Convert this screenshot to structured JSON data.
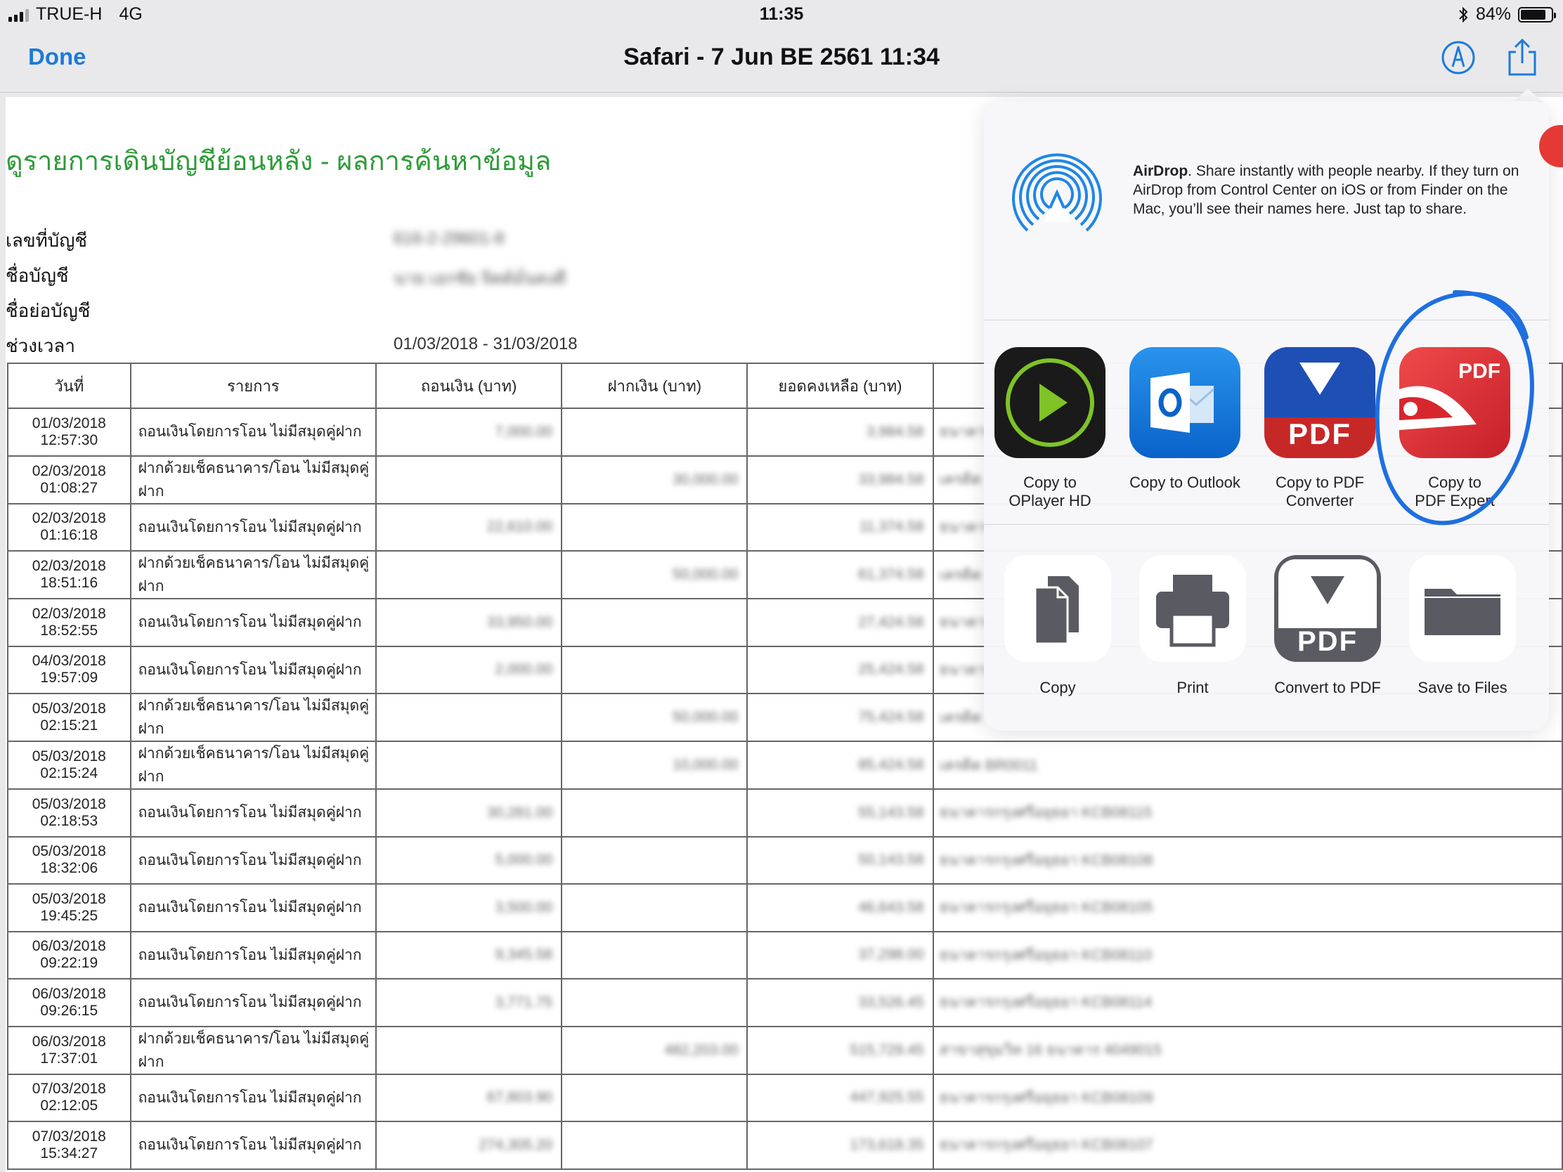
{
  "status_bar": {
    "carrier": "TRUE-H",
    "network": "4G",
    "time": "11:35",
    "battery_percent": "84%",
    "battery_level": 0.84
  },
  "nav": {
    "done_label": "Done",
    "title": "Safari - 7 Jun BE 2561 11:34"
  },
  "document": {
    "title": "ดูรายการเดินบัญชีย้อนหลัง - ผลการค้นหาข้อมูล",
    "fields": [
      {
        "label": "เลขที่บัญชี",
        "value": "616-2-29601-8"
      },
      {
        "label": "ชื่อบัญชี",
        "value": "นาย เอกชัย จิตต์มั่นคงดี"
      },
      {
        "label": "ชื่อย่อบัญชี",
        "value": ""
      },
      {
        "label": "ช่วงเวลา",
        "value": "01/03/2018 - 31/03/2018"
      }
    ],
    "table": {
      "headers": [
        "วันที่",
        "รายการ",
        "ถอนเงิน (บาท)",
        "ฝากเงิน (บาท)",
        "ยอดคงเหลือ (บาท)",
        ""
      ],
      "rows": [
        {
          "date": "01/03/2018",
          "time": "12:57:30",
          "desc": "ถอนเงินโดยการโอน ไม่มีสมุดคู่ฝาก",
          "withdraw": "7,000.00",
          "deposit": "",
          "balance": "3,984.58",
          "channel": "ธนาคาร"
        },
        {
          "date": "02/03/2018",
          "time": "01:08:27",
          "desc": "ฝากด้วยเช็คธนาคาร/โอน ไม่มีสมุดคู่ฝาก",
          "withdraw": "",
          "deposit": "30,000.00",
          "balance": "33,984.58",
          "channel": "เครดิต"
        },
        {
          "date": "02/03/2018",
          "time": "01:16:18",
          "desc": "ถอนเงินโดยการโอน ไม่มีสมุดคู่ฝาก",
          "withdraw": "22,610.00",
          "deposit": "",
          "balance": "11,374.58",
          "channel": "ธนาคาร"
        },
        {
          "date": "02/03/2018",
          "time": "18:51:16",
          "desc": "ฝากด้วยเช็คธนาคาร/โอน ไม่มีสมุดคู่ฝาก",
          "withdraw": "",
          "deposit": "50,000.00",
          "balance": "61,374.58",
          "channel": "เครดิต"
        },
        {
          "date": "02/03/2018",
          "time": "18:52:55",
          "desc": "ถอนเงินโดยการโอน ไม่มีสมุดคู่ฝาก",
          "withdraw": "33,950.00",
          "deposit": "",
          "balance": "27,424.58",
          "channel": "ธนาคาร"
        },
        {
          "date": "04/03/2018",
          "time": "19:57:09",
          "desc": "ถอนเงินโดยการโอน ไม่มีสมุดคู่ฝาก",
          "withdraw": "2,000.00",
          "deposit": "",
          "balance": "25,424.58",
          "channel": "ธนาคาร"
        },
        {
          "date": "05/03/2018",
          "time": "02:15:21",
          "desc": "ฝากด้วยเช็คธนาคาร/โอน ไม่มีสมุดคู่ฝาก",
          "withdraw": "",
          "deposit": "50,000.00",
          "balance": "75,424.58",
          "channel": "เครดิต"
        },
        {
          "date": "05/03/2018",
          "time": "02:15:24",
          "desc": "ฝากด้วยเช็คธนาคาร/โอน ไม่มีสมุดคู่ฝาก",
          "withdraw": "",
          "deposit": "10,000.00",
          "balance": "85,424.58",
          "channel": "เครดิต BR0011"
        },
        {
          "date": "05/03/2018",
          "time": "02:18:53",
          "desc": "ถอนเงินโดยการโอน ไม่มีสมุดคู่ฝาก",
          "withdraw": "30,281.00",
          "deposit": "",
          "balance": "55,143.58",
          "channel": "ธนาคารกรุงศรีอยุธยา KCB08115"
        },
        {
          "date": "05/03/2018",
          "time": "18:32:06",
          "desc": "ถอนเงินโดยการโอน ไม่มีสมุดคู่ฝาก",
          "withdraw": "5,000.00",
          "deposit": "",
          "balance": "50,143.58",
          "channel": "ธนาคารกรุงศรีอยุธยา KCB08108"
        },
        {
          "date": "05/03/2018",
          "time": "19:45:25",
          "desc": "ถอนเงินโดยการโอน ไม่มีสมุดคู่ฝาก",
          "withdraw": "3,500.00",
          "deposit": "",
          "balance": "46,643.58",
          "channel": "ธนาคารกรุงศรีอยุธยา KCB08105"
        },
        {
          "date": "06/03/2018",
          "time": "09:22:19",
          "desc": "ถอนเงินโดยการโอน ไม่มีสมุดคู่ฝาก",
          "withdraw": "9,345.58",
          "deposit": "",
          "balance": "37,298.00",
          "channel": "ธนาคารกรุงศรีอยุธยา KCB08110"
        },
        {
          "date": "06/03/2018",
          "time": "09:26:15",
          "desc": "ถอนเงินโดยการโอน ไม่มีสมุดคู่ฝาก",
          "withdraw": "3,771.75",
          "deposit": "",
          "balance": "33,526.45",
          "channel": "ธนาคารกรุงศรีอยุธยา KCB08114"
        },
        {
          "date": "06/03/2018",
          "time": "17:37:01",
          "desc": "ฝากด้วยเช็คธนาคาร/โอน ไม่มีสมุดคู่ฝาก",
          "withdraw": "",
          "deposit": "482,203.00",
          "balance": "515,729.45",
          "channel": "สาขาสุขุมวิท 16 ธนาคาร 4049015"
        },
        {
          "date": "07/03/2018",
          "time": "02:12:05",
          "desc": "ถอนเงินโดยการโอน ไม่มีสมุดคู่ฝาก",
          "withdraw": "67,803.90",
          "deposit": "",
          "balance": "447,925.55",
          "channel": "ธนาคารกรุงศรีอยุธยา KCB08109"
        },
        {
          "date": "07/03/2018",
          "time": "15:34:27",
          "desc": "ถอนเงินโดยการโอน ไม่มีสมุดคู่ฝาก",
          "withdraw": "274,305.20",
          "deposit": "",
          "balance": "173,618.35",
          "channel": "ธนาคารกรุงศรีอยุธยา KCB08107"
        }
      ]
    }
  },
  "share_sheet": {
    "airdrop_title": "AirDrop",
    "airdrop_text": ". Share instantly with people nearby. If they turn on AirDrop from Control Center on iOS or from Finder on the Mac, you’ll see their names here. Just tap to share.",
    "apps": [
      {
        "label1": "Copy to",
        "label2": "OPlayer HD",
        "icon": "oplayer-icon"
      },
      {
        "label1": "Copy to Outlook",
        "label2": "",
        "icon": "outlook-icon"
      },
      {
        "label1": "Copy to PDF",
        "label2": "Converter",
        "icon": "pdf-converter-icon",
        "badge": "PDF"
      },
      {
        "label1": "Copy to",
        "label2": "PDF Expert",
        "icon": "pdf-expert-icon",
        "badge": "PDF"
      }
    ],
    "actions": [
      {
        "label": "Copy",
        "icon": "copy-icon"
      },
      {
        "label": "Print",
        "icon": "print-icon"
      },
      {
        "label": "Convert to PDF",
        "icon": "convert-pdf-icon",
        "badge": "PDF"
      },
      {
        "label": "Save to Files",
        "icon": "folder-icon"
      }
    ]
  },
  "colors": {
    "accent": "#1c7bd9",
    "doc_title": "#2e9b38",
    "annotation": "#1e6fe0"
  }
}
